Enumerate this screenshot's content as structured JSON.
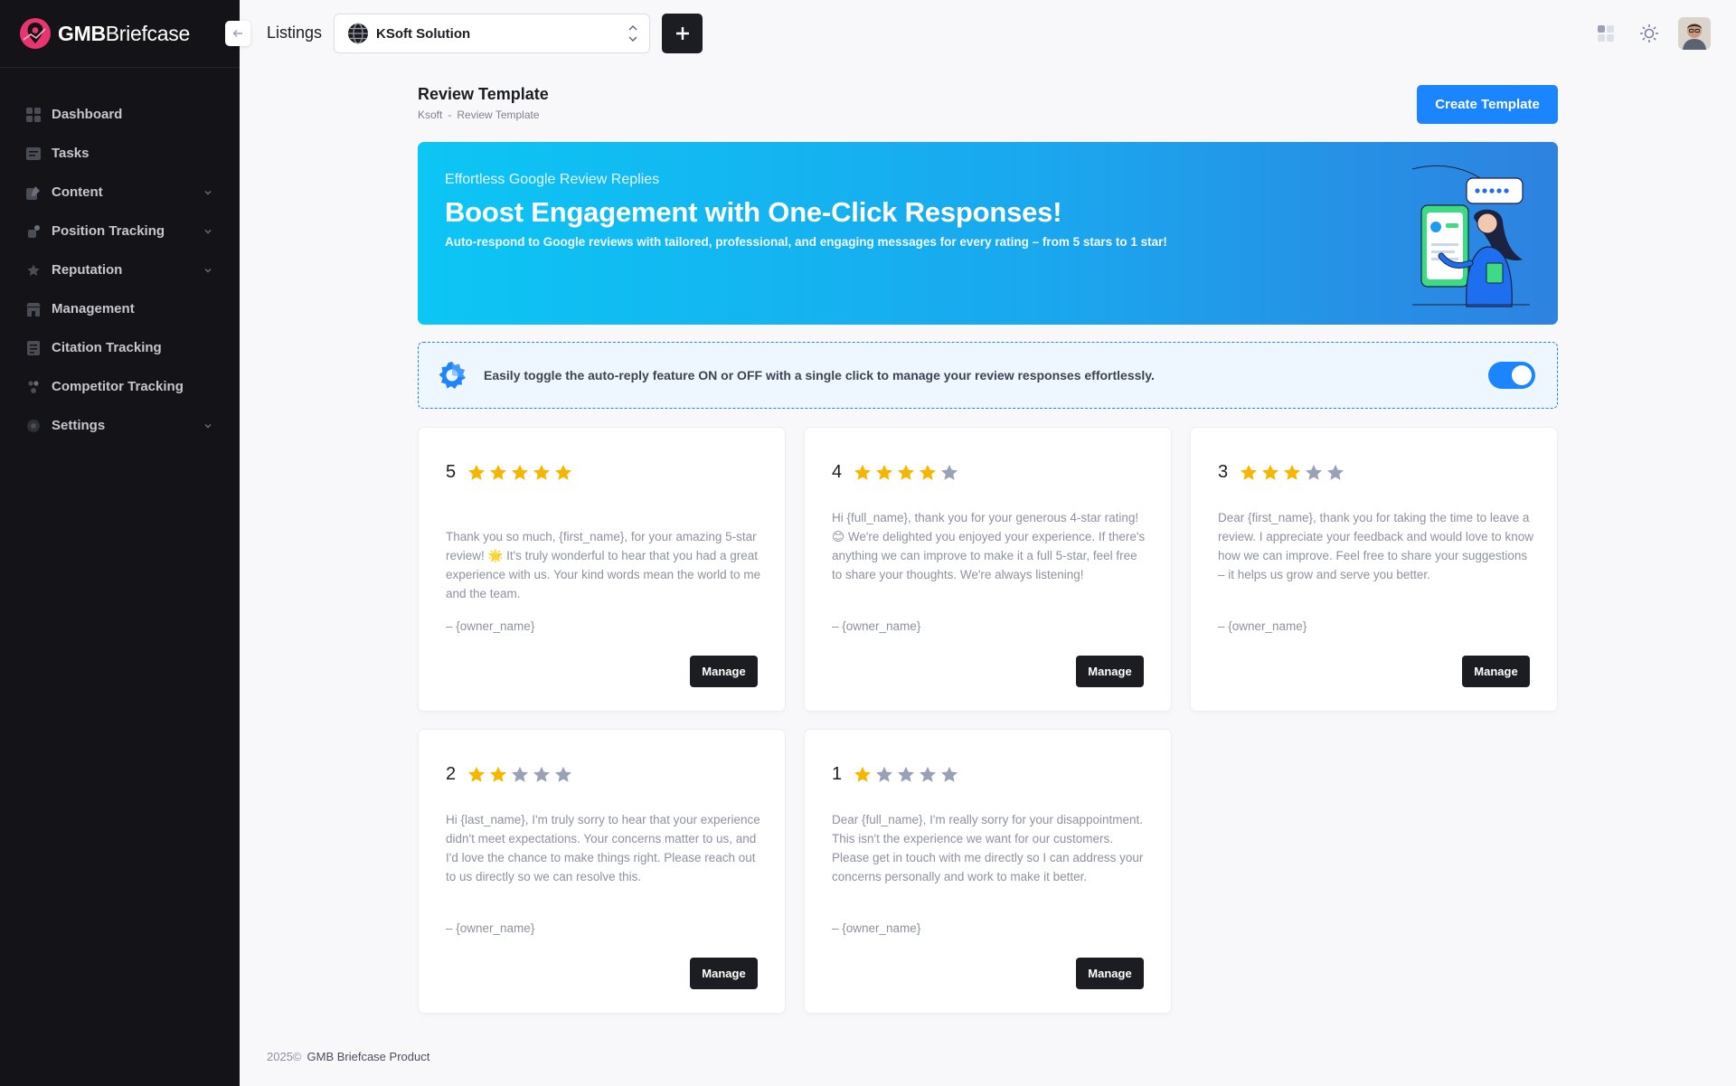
{
  "brand": {
    "name_bold": "GMB",
    "name_regular": "Briefcase"
  },
  "sidebar": {
    "items": [
      {
        "label": "Dashboard",
        "icon": "dashboard-icon",
        "has_submenu": false
      },
      {
        "label": "Tasks",
        "icon": "tasks-icon",
        "has_submenu": false
      },
      {
        "label": "Content",
        "icon": "content-icon",
        "has_submenu": true
      },
      {
        "label": "Position Tracking",
        "icon": "position-tracking-icon",
        "has_submenu": true
      },
      {
        "label": "Reputation",
        "icon": "star-icon",
        "has_submenu": true
      },
      {
        "label": "Management",
        "icon": "store-icon",
        "has_submenu": false
      },
      {
        "label": "Citation Tracking",
        "icon": "citation-icon",
        "has_submenu": false
      },
      {
        "label": "Competitor Tracking",
        "icon": "competitor-icon",
        "has_submenu": false
      },
      {
        "label": "Settings",
        "icon": "settings-icon",
        "has_submenu": true
      }
    ]
  },
  "topbar": {
    "listings_label": "Listings",
    "selected_listing": "KSoft Solution",
    "add_label": "+"
  },
  "page": {
    "title": "Review Template",
    "breadcrumb": [
      "Ksoft",
      "-",
      "Review Template"
    ],
    "create_button": "Create Template"
  },
  "banner": {
    "subtitle": "Effortless Google Review Replies",
    "title": "Boost Engagement with One-Click Responses!",
    "description": "Auto-respond to Google reviews with tailored, professional, and engaging messages for every rating – from 5 stars to 1 star!"
  },
  "auto_reply": {
    "text": "Easily toggle the auto-reply feature ON or OFF with a single click to manage your review responses effortlessly.",
    "enabled": true
  },
  "templates": [
    {
      "rating": "5",
      "stars": 5,
      "message": "Thank you so much, {first_name}, for your amazing 5-star review! 🌟 It's truly wonderful to hear that you had a great experience with us. Your kind words mean the world to me and the team.",
      "signature": "– {owner_name}",
      "button": "Manage"
    },
    {
      "rating": "4",
      "stars": 4,
      "message": "Hi {full_name}, thank you for your generous 4-star rating! 😊 We're delighted you enjoyed your experience. If there's anything we can improve to make it a full 5-star, feel free to share your thoughts. We're always listening!",
      "signature": "– {owner_name}",
      "button": "Manage"
    },
    {
      "rating": "3",
      "stars": 3,
      "message": "Dear {first_name}, thank you for taking the time to leave a review. I appreciate your feedback and would love to know how we can improve. Feel free to share your suggestions – it helps us grow and serve you better.",
      "signature": "– {owner_name}",
      "button": "Manage"
    },
    {
      "rating": "2",
      "stars": 2,
      "message": "Hi {last_name}, I'm truly sorry to hear that your experience didn't meet expectations. Your concerns matter to us, and I'd love the chance to make things right. Please reach out to us directly so we can resolve this.",
      "signature": "– {owner_name}",
      "button": "Manage"
    },
    {
      "rating": "1",
      "stars": 1,
      "message": "Dear {full_name}, I'm really sorry for your disappointment. This isn't the experience we want for our customers. Please get in touch with me directly so I can address your concerns personally and work to make it better.",
      "signature": "– {owner_name}",
      "button": "Manage"
    }
  ],
  "footer": {
    "year": "2025©",
    "text": "GMB Briefcase Product"
  },
  "colors": {
    "accent": "#1b84ff",
    "sidebar_bg": "#141418",
    "star_filled": "#f6b600",
    "star_empty": "#99a1b7"
  }
}
